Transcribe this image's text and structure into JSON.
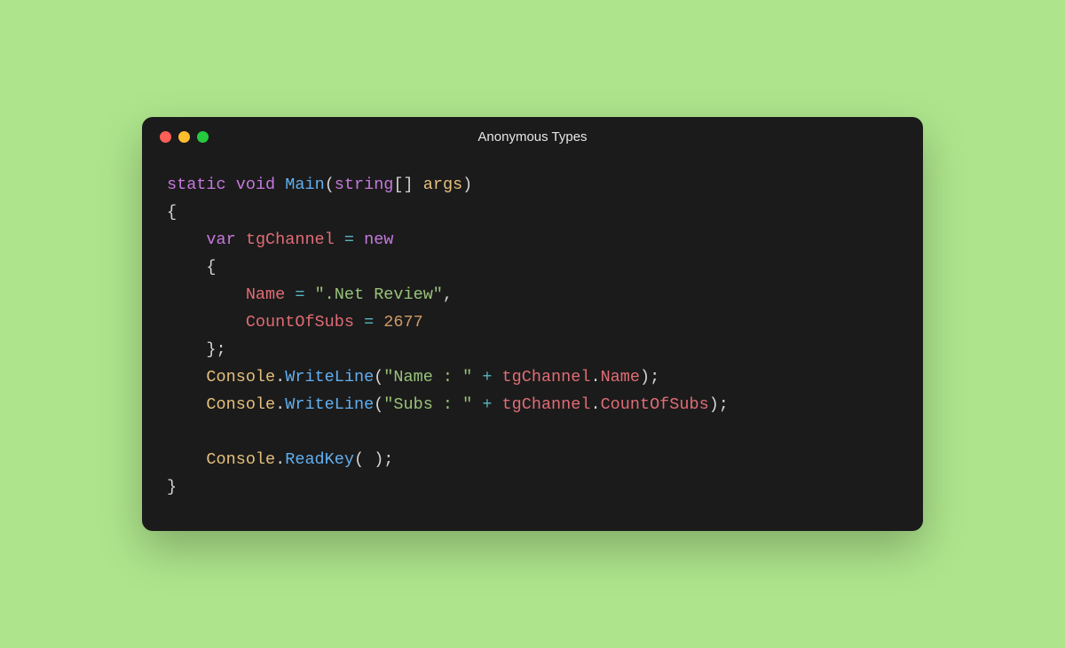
{
  "window": {
    "title": "Anonymous Types"
  },
  "code": {
    "kw_static": "static",
    "kw_void": "void",
    "fn_main": "Main",
    "type_string": "string",
    "brackets": "[]",
    "param_args": "args",
    "open_curly": "{",
    "close_curly": "}",
    "kw_var": "var",
    "ident_tgChannel": "tgChannel",
    "op_assign": "=",
    "kw_new": "new",
    "prop_Name": "Name",
    "str_netreview": "\".Net Review\"",
    "comma": ",",
    "prop_CountOfSubs": "CountOfSubs",
    "num_2677": "2677",
    "semi": ";",
    "close_init": "};",
    "cls_Console": "Console",
    "dot": ".",
    "method_WriteLine": "WriteLine",
    "str_name": "\"Name : \"",
    "op_plus": "+",
    "str_subs": "\"Subs : \"",
    "method_ReadKey": "ReadKey",
    "paren_open": "(",
    "paren_close": ")",
    "space": " "
  }
}
